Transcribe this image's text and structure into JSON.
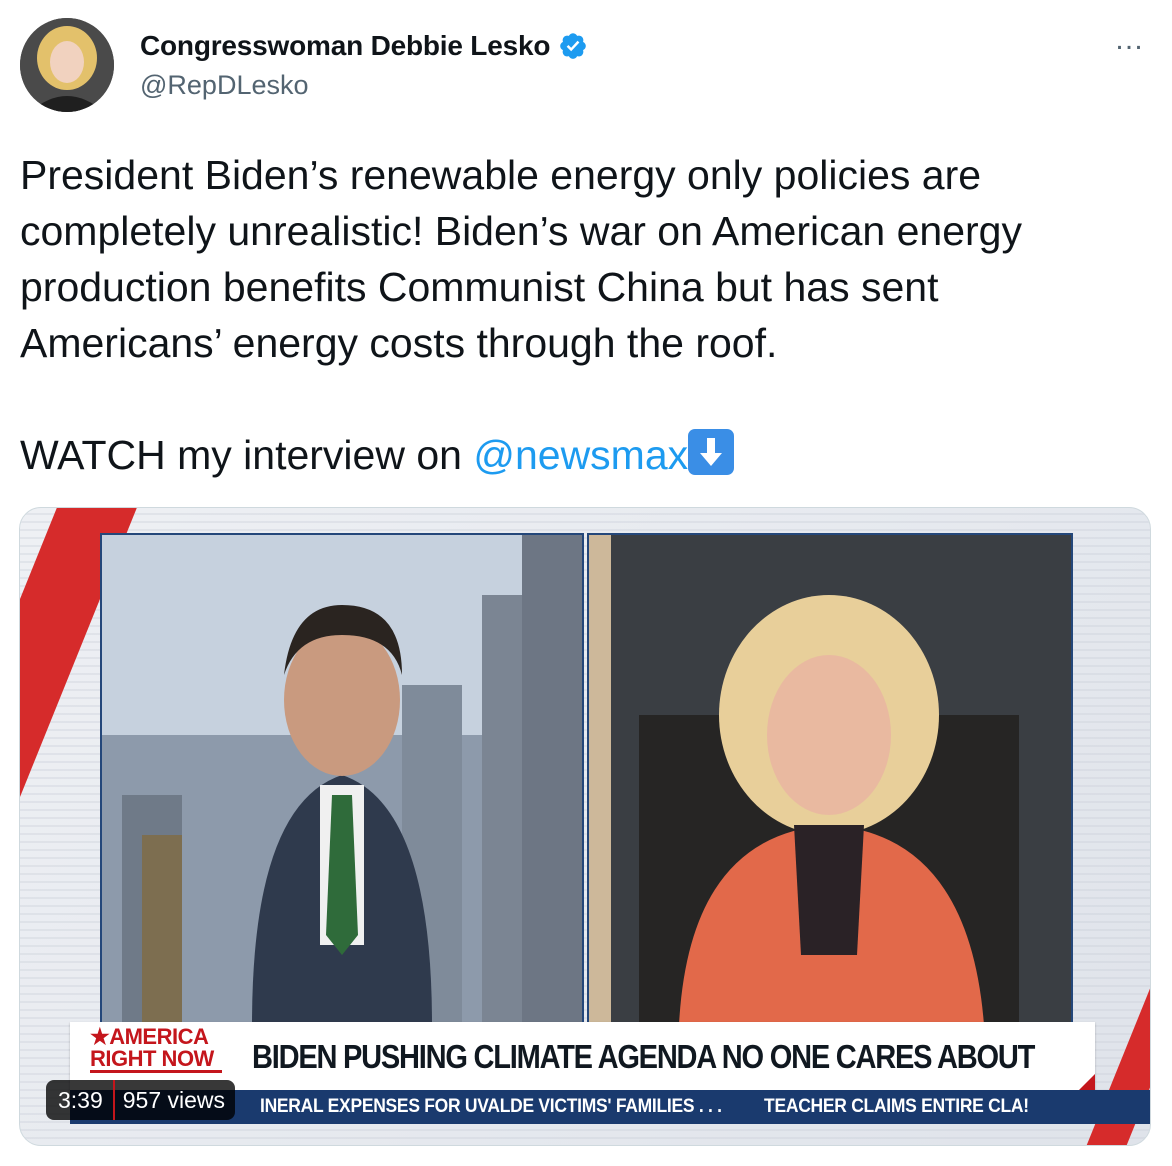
{
  "author": {
    "display_name": "Congresswoman Debbie Lesko",
    "handle": "@RepDLesko",
    "verified": true
  },
  "more_icon": "…",
  "tweet": {
    "line1": "President Biden’s renewable energy only policies are",
    "line2": "completely unrealistic! Biden’s war on American energy",
    "line3": "production benefits Communist China but has sent",
    "line4": "Americans’ energy costs through the roof.",
    "watch_prefix": "WATCH my interview on ",
    "mention": "@newsmax",
    "emoji": "down-arrow-emoji"
  },
  "video": {
    "logo_line1": "★AMERICA",
    "logo_line2": "RIGHT NOW",
    "headline": "BIDEN PUSHING CLIMATE AGENDA NO ONE CARES ABOUT",
    "ticker_item1": "INERAL EXPENSES FOR UVALDE VICTIMS' FAMILIES . . .",
    "ticker_item2": "TEACHER CLAIMS ENTIRE CLA!",
    "duration": "3:39",
    "views": "957 views"
  },
  "colors": {
    "link": "#1d9bf0",
    "verified": "#1d9bf0",
    "chyron_red": "#c4161c",
    "ticker_blue": "#1a3a6e"
  }
}
